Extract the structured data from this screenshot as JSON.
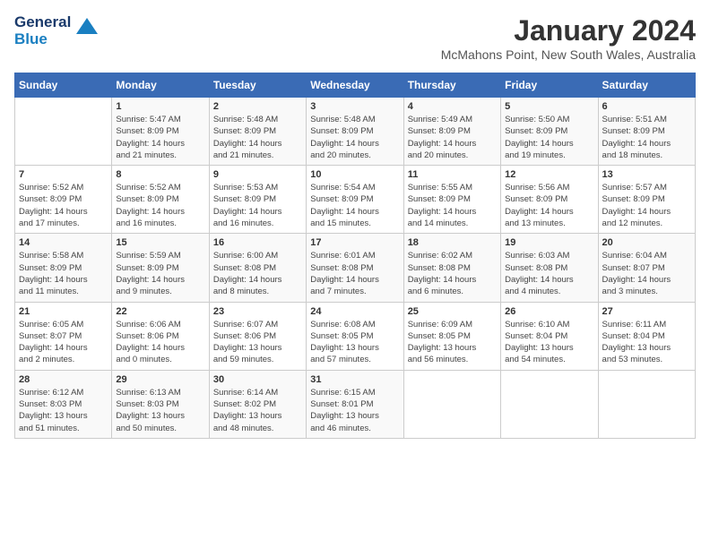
{
  "header": {
    "logo_general": "General",
    "logo_blue": "Blue",
    "title": "January 2024",
    "subtitle": "McMahons Point, New South Wales, Australia"
  },
  "calendar": {
    "weekdays": [
      "Sunday",
      "Monday",
      "Tuesday",
      "Wednesday",
      "Thursday",
      "Friday",
      "Saturday"
    ],
    "weeks": [
      [
        {
          "day": "",
          "info": ""
        },
        {
          "day": "1",
          "info": "Sunrise: 5:47 AM\nSunset: 8:09 PM\nDaylight: 14 hours\nand 21 minutes."
        },
        {
          "day": "2",
          "info": "Sunrise: 5:48 AM\nSunset: 8:09 PM\nDaylight: 14 hours\nand 21 minutes."
        },
        {
          "day": "3",
          "info": "Sunrise: 5:48 AM\nSunset: 8:09 PM\nDaylight: 14 hours\nand 20 minutes."
        },
        {
          "day": "4",
          "info": "Sunrise: 5:49 AM\nSunset: 8:09 PM\nDaylight: 14 hours\nand 20 minutes."
        },
        {
          "day": "5",
          "info": "Sunrise: 5:50 AM\nSunset: 8:09 PM\nDaylight: 14 hours\nand 19 minutes."
        },
        {
          "day": "6",
          "info": "Sunrise: 5:51 AM\nSunset: 8:09 PM\nDaylight: 14 hours\nand 18 minutes."
        }
      ],
      [
        {
          "day": "7",
          "info": "Sunrise: 5:52 AM\nSunset: 8:09 PM\nDaylight: 14 hours\nand 17 minutes."
        },
        {
          "day": "8",
          "info": "Sunrise: 5:52 AM\nSunset: 8:09 PM\nDaylight: 14 hours\nand 16 minutes."
        },
        {
          "day": "9",
          "info": "Sunrise: 5:53 AM\nSunset: 8:09 PM\nDaylight: 14 hours\nand 16 minutes."
        },
        {
          "day": "10",
          "info": "Sunrise: 5:54 AM\nSunset: 8:09 PM\nDaylight: 14 hours\nand 15 minutes."
        },
        {
          "day": "11",
          "info": "Sunrise: 5:55 AM\nSunset: 8:09 PM\nDaylight: 14 hours\nand 14 minutes."
        },
        {
          "day": "12",
          "info": "Sunrise: 5:56 AM\nSunset: 8:09 PM\nDaylight: 14 hours\nand 13 minutes."
        },
        {
          "day": "13",
          "info": "Sunrise: 5:57 AM\nSunset: 8:09 PM\nDaylight: 14 hours\nand 12 minutes."
        }
      ],
      [
        {
          "day": "14",
          "info": "Sunrise: 5:58 AM\nSunset: 8:09 PM\nDaylight: 14 hours\nand 11 minutes."
        },
        {
          "day": "15",
          "info": "Sunrise: 5:59 AM\nSunset: 8:09 PM\nDaylight: 14 hours\nand 9 minutes."
        },
        {
          "day": "16",
          "info": "Sunrise: 6:00 AM\nSunset: 8:08 PM\nDaylight: 14 hours\nand 8 minutes."
        },
        {
          "day": "17",
          "info": "Sunrise: 6:01 AM\nSunset: 8:08 PM\nDaylight: 14 hours\nand 7 minutes."
        },
        {
          "day": "18",
          "info": "Sunrise: 6:02 AM\nSunset: 8:08 PM\nDaylight: 14 hours\nand 6 minutes."
        },
        {
          "day": "19",
          "info": "Sunrise: 6:03 AM\nSunset: 8:08 PM\nDaylight: 14 hours\nand 4 minutes."
        },
        {
          "day": "20",
          "info": "Sunrise: 6:04 AM\nSunset: 8:07 PM\nDaylight: 14 hours\nand 3 minutes."
        }
      ],
      [
        {
          "day": "21",
          "info": "Sunrise: 6:05 AM\nSunset: 8:07 PM\nDaylight: 14 hours\nand 2 minutes."
        },
        {
          "day": "22",
          "info": "Sunrise: 6:06 AM\nSunset: 8:06 PM\nDaylight: 14 hours\nand 0 minutes."
        },
        {
          "day": "23",
          "info": "Sunrise: 6:07 AM\nSunset: 8:06 PM\nDaylight: 13 hours\nand 59 minutes."
        },
        {
          "day": "24",
          "info": "Sunrise: 6:08 AM\nSunset: 8:05 PM\nDaylight: 13 hours\nand 57 minutes."
        },
        {
          "day": "25",
          "info": "Sunrise: 6:09 AM\nSunset: 8:05 PM\nDaylight: 13 hours\nand 56 minutes."
        },
        {
          "day": "26",
          "info": "Sunrise: 6:10 AM\nSunset: 8:04 PM\nDaylight: 13 hours\nand 54 minutes."
        },
        {
          "day": "27",
          "info": "Sunrise: 6:11 AM\nSunset: 8:04 PM\nDaylight: 13 hours\nand 53 minutes."
        }
      ],
      [
        {
          "day": "28",
          "info": "Sunrise: 6:12 AM\nSunset: 8:03 PM\nDaylight: 13 hours\nand 51 minutes."
        },
        {
          "day": "29",
          "info": "Sunrise: 6:13 AM\nSunset: 8:03 PM\nDaylight: 13 hours\nand 50 minutes."
        },
        {
          "day": "30",
          "info": "Sunrise: 6:14 AM\nSunset: 8:02 PM\nDaylight: 13 hours\nand 48 minutes."
        },
        {
          "day": "31",
          "info": "Sunrise: 6:15 AM\nSunset: 8:01 PM\nDaylight: 13 hours\nand 46 minutes."
        },
        {
          "day": "",
          "info": ""
        },
        {
          "day": "",
          "info": ""
        },
        {
          "day": "",
          "info": ""
        }
      ]
    ]
  }
}
